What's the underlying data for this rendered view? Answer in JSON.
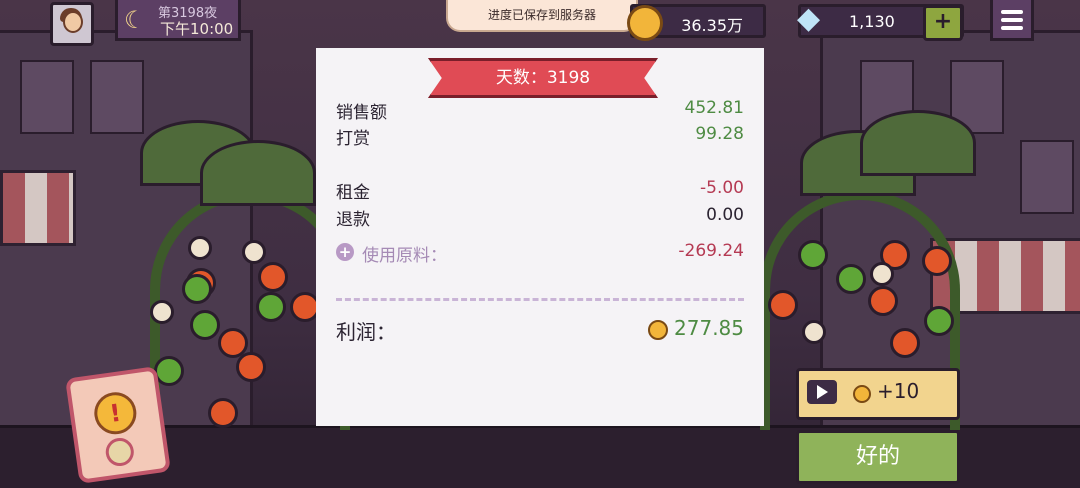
{
  "hud": {
    "night_label": "第3198夜",
    "time": "下午10:00",
    "toast": "进度已保存到服务器",
    "coins": "36.35万",
    "gems": "1,130",
    "plus": "+"
  },
  "receipt": {
    "day_banner": "天数：3198",
    "rows": [
      {
        "label": "销售额",
        "value": "452.81"
      },
      {
        "label": "打赏",
        "value": "99.28"
      },
      {
        "label": "租金",
        "value": "-5.00"
      },
      {
        "label": "退款",
        "value": "0.00"
      }
    ],
    "ingredients": {
      "label": "使用原料：",
      "value": "-269.24"
    },
    "profit": {
      "label": "利润：",
      "value": "277.85"
    }
  },
  "buttons": {
    "ad_reward": "+10",
    "ok": "好的"
  },
  "colors": {
    "positive": "#4e8b43",
    "negative": "#b53a53",
    "banner": "#e04b55",
    "ok_button": "#8fb35a"
  },
  "icons": [
    "avatar",
    "moon-icon",
    "coin-icon",
    "diamond-icon",
    "plus-icon",
    "menu-icon",
    "add-circle-icon",
    "play-video-icon",
    "alert-icon"
  ]
}
